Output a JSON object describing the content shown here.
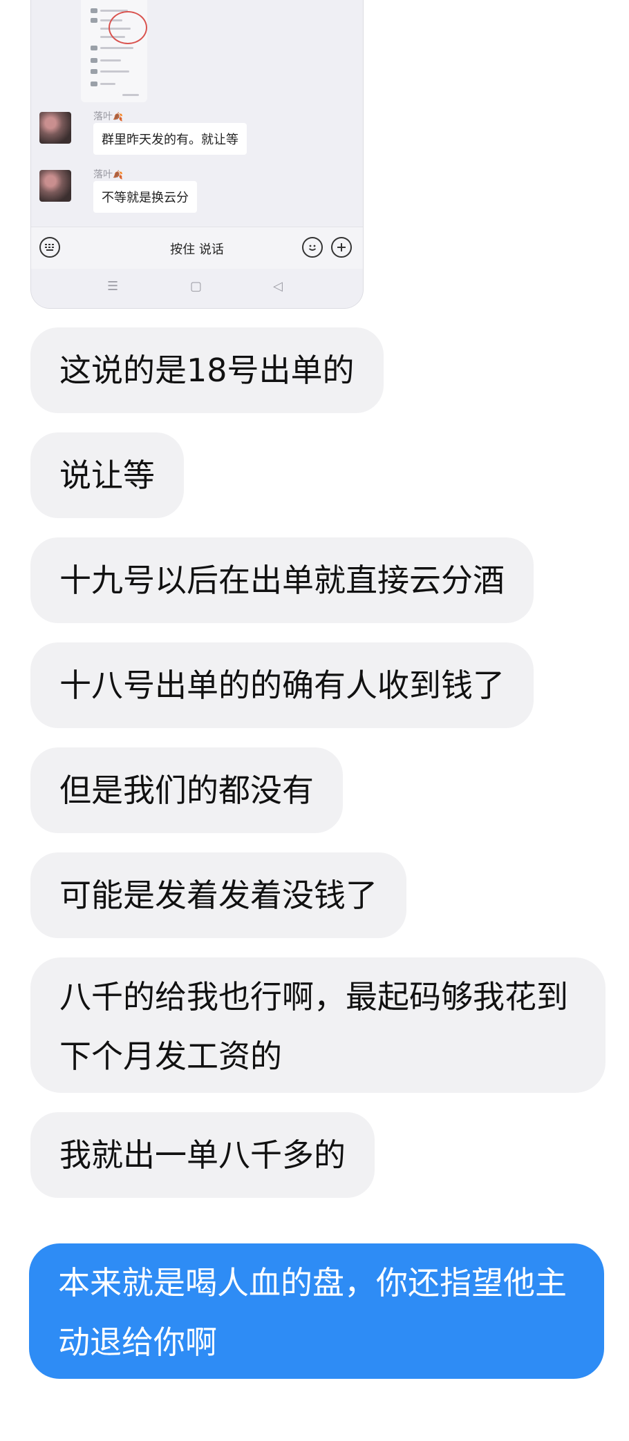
{
  "embedded_screenshot": {
    "messages": [
      {
        "sender": "落叶",
        "sender_badge": "🍂",
        "text": "群里昨天发的有。就让等"
      },
      {
        "sender": "落叶",
        "sender_badge": "🍂",
        "text": "不等就是换云分"
      }
    ],
    "input_bar": {
      "keyboard_icon": "keyboard-icon",
      "hold_to_talk": "按住 说话",
      "emoji_icon": "emoji-icon",
      "add_icon": "plus-icon"
    },
    "nav_bar": {
      "menu": "☰",
      "home": "▢",
      "back": "◁"
    }
  },
  "chat": {
    "received": [
      "这说的是18号出单的",
      "说让等",
      "十九号以后在出单就直接云分酒",
      "十八号出单的的确有人收到钱了",
      "但是我们的都没有",
      "可能是发着发着没钱了",
      "八千的给我也行啊，最起码够我花到下个月发工资的",
      "我就出一单八千多的"
    ],
    "sent": [
      "本来就是喝人血的盘，你还指望他主动退给你啊"
    ]
  },
  "colors": {
    "received_bubble": "#f1f1f3",
    "sent_bubble": "#2e8cf5",
    "sent_text": "#ffffff"
  }
}
